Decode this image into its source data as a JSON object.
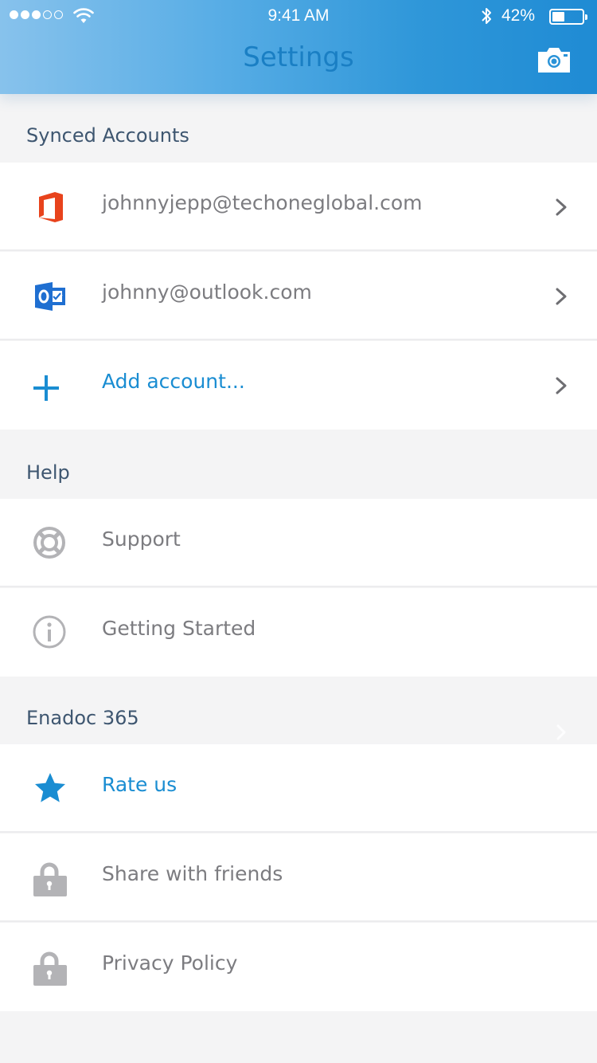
{
  "status_bar": {
    "time": "9:41 AM",
    "battery_percent": "42%",
    "battery_level": 0.42,
    "signal_bars": 3,
    "signal_total": 5
  },
  "nav": {
    "title": "Settings",
    "right_icon": "camera-icon"
  },
  "sections": {
    "synced_accounts": {
      "title": "Synced Accounts",
      "rows": [
        {
          "label": "johnnyjepp@techoneglobal.com",
          "icon": "office-icon"
        },
        {
          "label": "johnny@outlook.com",
          "icon": "outlook-icon"
        },
        {
          "label": "Add account...",
          "icon": "plus-icon"
        }
      ]
    },
    "help": {
      "title": "Help",
      "rows": [
        {
          "label": "Support",
          "icon": "lifebuoy-icon"
        },
        {
          "label": "Getting Started",
          "icon": "info-icon"
        }
      ]
    },
    "app": {
      "title": "Enadoc 365",
      "rows": [
        {
          "label": "Rate us",
          "icon": "star-icon"
        },
        {
          "label": "Share with friends",
          "icon": "lock-icon"
        },
        {
          "label": "Privacy Policy",
          "icon": "lock-icon"
        }
      ]
    }
  },
  "colors": {
    "accent": "#1a8dd2",
    "header_start": "#87c2ec",
    "header_end": "#1f8bd4",
    "office_red": "#e8431c",
    "outlook_blue": "#1f6fd1",
    "muted_icon": "#b3b3b6",
    "label_text": "#7c7c80",
    "section_text": "#3e5670",
    "background": "#f4f4f5"
  }
}
